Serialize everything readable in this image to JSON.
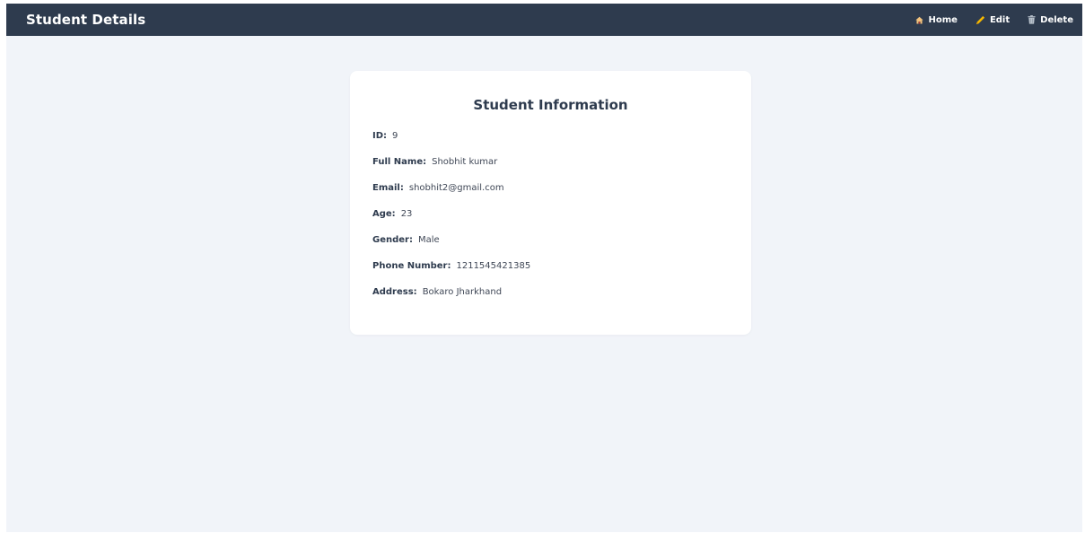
{
  "header": {
    "title": "Student Details",
    "nav": [
      {
        "label": "Home",
        "icon": "home-icon"
      },
      {
        "label": "Edit",
        "icon": "pencil-icon"
      },
      {
        "label": "Delete",
        "icon": "trash-icon"
      }
    ]
  },
  "card": {
    "title": "Student Information",
    "fields": [
      {
        "label": "ID:",
        "value": "9"
      },
      {
        "label": "Full Name:",
        "value": "Shobhit kumar"
      },
      {
        "label": "Email:",
        "value": "shobhit2@gmail.com"
      },
      {
        "label": "Age:",
        "value": "23"
      },
      {
        "label": "Gender:",
        "value": "Male"
      },
      {
        "label": "Phone Number:",
        "value": "1211545421385"
      },
      {
        "label": "Address:",
        "value": "Bokaro Jharkhand"
      }
    ]
  },
  "colors": {
    "header_bg": "#2e3b4e",
    "page_bg": "#f1f4f9",
    "card_bg": "#ffffff",
    "edit_icon": "#f5b800",
    "home_icon": "#f1c27d",
    "delete_icon": "#b9c2cc"
  }
}
